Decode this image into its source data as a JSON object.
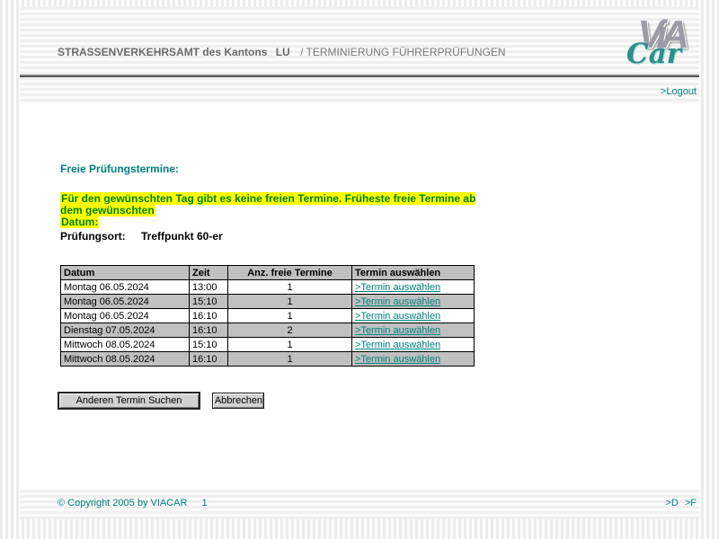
{
  "header": {
    "title_office": "STRASSENVERKEHRSAMT des Kantons",
    "title_canton": "LU",
    "title_app": "/ TERMINIERUNG FÜHRERPRÜFUNGEN",
    "logo": {
      "via": "ViA",
      "car": "Car"
    },
    "logout_label": ">Logout"
  },
  "main": {
    "heading": "Freie Prüfungstermine:",
    "notice_line1": "Für den gewünschten Tag gibt es keine freien Termine. Früheste freie Termine ab dem gewünschten",
    "notice_line2": "Datum:",
    "location_label": "Prüfungsort:",
    "location_value": "Treffpunkt 60-er",
    "table": {
      "columns": [
        "Datum",
        "Zeit",
        "Anz. freie Termine",
        "Termin auswählen"
      ],
      "rows": [
        {
          "datum": "Montag 06.05.2024",
          "zeit": "13:00",
          "anzahl": "1",
          "link": ">Termin auswählen"
        },
        {
          "datum": "Montag 06.05.2024",
          "zeit": "15:10",
          "anzahl": "1",
          "link": ">Termin auswählen"
        },
        {
          "datum": "Montag 06.05.2024",
          "zeit": "16:10",
          "anzahl": "1",
          "link": ">Termin auswählen"
        },
        {
          "datum": "Dienstag 07.05.2024",
          "zeit": "16:10",
          "anzahl": "2",
          "link": ">Termin auswählen"
        },
        {
          "datum": "Mittwoch 08.05.2024",
          "zeit": "15:10",
          "anzahl": "1",
          "link": ">Termin auswählen"
        },
        {
          "datum": "Mittwoch 08.05.2024",
          "zeit": "16:10",
          "anzahl": "1",
          "link": ">Termin auswählen"
        }
      ]
    },
    "buttons": {
      "search_other": "Anderen Termin Suchen",
      "cancel": "Abbrechen"
    }
  },
  "footer": {
    "copyright": "© Copyright 2005 by VIACAR",
    "page_number": "1",
    "lang_d": ">D",
    "lang_f": ">F"
  },
  "colors": {
    "accent_teal": "#008080",
    "notice_green": "#008000",
    "highlight_yellow": "#ffff00",
    "table_silver": "#c0c0c0",
    "header_gray": "#6a6a6a"
  }
}
